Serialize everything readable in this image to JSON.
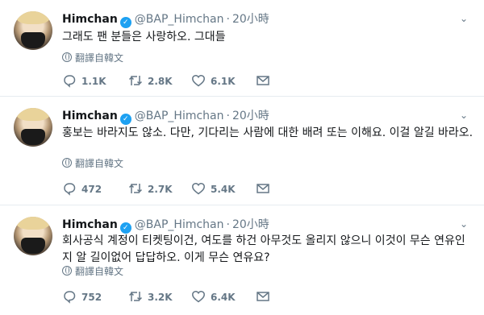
{
  "tweets": [
    {
      "name": "Himchan",
      "handle": "@BAP_Himchan",
      "dot": "·",
      "time": "20小時",
      "text": "그래도 팬 분들은 사랑하오. 그대들",
      "translate_label": "翻譯自韓文",
      "replies": "1.1K",
      "retweets": "2.8K",
      "likes": "6.1K"
    },
    {
      "name": "Himchan",
      "handle": "@BAP_Himchan",
      "dot": "·",
      "time": "20小時",
      "text": "홍보는 바라지도 않소. 다만, 기다리는 사람에 대한 배려 또는 이해요. 이걸 알길 바라오.",
      "translate_label": "翻譯自韓文",
      "replies": "472",
      "retweets": "2.7K",
      "likes": "5.4K"
    },
    {
      "name": "Himchan",
      "handle": "@BAP_Himchan",
      "dot": "·",
      "time": "20小時",
      "text": "회사공식 계정이 티켓팅이건, 여도를 하건 아무것도 올리지 않으니 이것이 무슨 연유인지 알 길이없어 답답하오. 이게 무슨 연유요?",
      "translate_label": "翻譯自韓文",
      "replies": "752",
      "retweets": "3.2K",
      "likes": "6.4K"
    }
  ],
  "icons": {
    "verified": "verified-badge-icon",
    "caret": "chevron-down-icon",
    "translate": "globe-icon",
    "reply": "reply-icon",
    "retweet": "retweet-icon",
    "like": "heart-icon",
    "dm": "envelope-icon"
  },
  "colors": {
    "verified": "#1da1f2",
    "secondary_text": "#657786",
    "divider": "#e6ecf0"
  }
}
